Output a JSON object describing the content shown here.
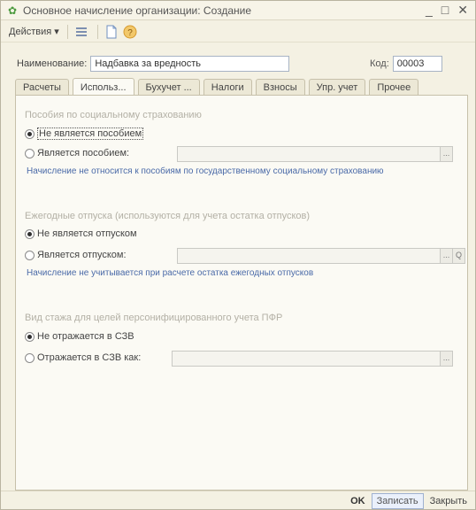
{
  "window": {
    "title": "Основное начисление организации: Создание",
    "controls": {
      "minimize": "_",
      "restore": "□",
      "close": "✕"
    }
  },
  "toolbar": {
    "actions_label": "Действия",
    "actions_arrow": "▾",
    "icons": [
      "list-icon",
      "document-icon",
      "help-icon"
    ]
  },
  "form": {
    "name_label": "Наименование:",
    "name_value": "Надбавка за вредность",
    "code_label": "Код:",
    "code_value": "00003"
  },
  "tabs": [
    {
      "label": "Расчеты",
      "active": false
    },
    {
      "label": "Использ...",
      "active": true
    },
    {
      "label": "Бухучет ...",
      "active": false
    },
    {
      "label": "Налоги",
      "active": false
    },
    {
      "label": "Взносы",
      "active": false
    },
    {
      "label": "Упр. учет",
      "active": false
    },
    {
      "label": "Прочее",
      "active": false
    }
  ],
  "sections": {
    "social": {
      "title": "Пособия по социальному страхованию",
      "option1": "Не является пособием",
      "option2": "Является пособием:",
      "note": "Начисление не относится к пособиям по государственному социальному страхованию"
    },
    "vacation": {
      "title": "Ежегодные отпуска (используются для учета остатка отпусков)",
      "option1": "Не является отпуском",
      "option2": "Является отпуском:",
      "note": "Начисление не учитывается при расчете остатка ежегодных отпусков"
    },
    "pfr": {
      "title": "Вид стажа для целей персонифицированного учета ПФР",
      "option1": "Не отражается в СЗВ",
      "option2": "Отражается в СЗВ как:"
    }
  },
  "buttons": {
    "field_select": "...",
    "field_search": "Q"
  },
  "footer": {
    "ok": "OK",
    "save": "Записать",
    "close": "Закрыть"
  },
  "colors": {
    "window_bg": "#f4f1e3",
    "panel_bg": "#fbfaf4",
    "note_text": "#4a6aa8",
    "section_title": "#b3b0a5",
    "accent_icon": "#4b9a3e"
  }
}
